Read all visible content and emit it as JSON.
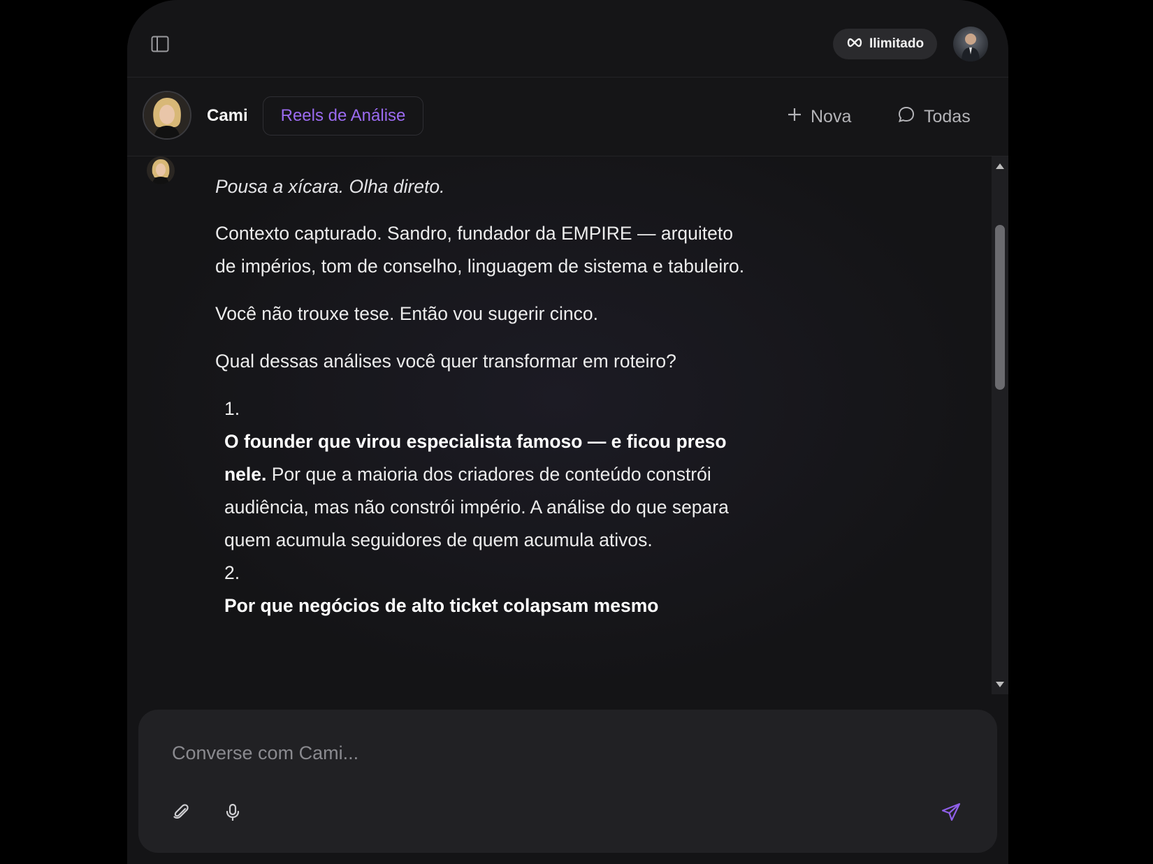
{
  "topbar": {
    "plan_label": "Ilimitado"
  },
  "header": {
    "agent_name": "Cami",
    "mode_label": "Reels de Análise",
    "new_label": "Nova",
    "all_label": "Todas"
  },
  "message": {
    "italic": "Pousa a xícara. Olha direto.",
    "para1": "Contexto capturado. Sandro, fundador da EMPIRE — arquiteto de impérios, tom de conselho, linguagem de sistema e tabuleiro.",
    "para2": "Você não trouxe tese. Então vou sugerir cinco.",
    "para3": "Qual dessas análises você quer transformar em roteiro?",
    "items": [
      {
        "num": "1.",
        "bold": "O founder que virou especialista famoso — e ficou preso nele.",
        "text": " Por que a maioria dos criadores de conteúdo constrói audiência, mas não constrói império. A análise do que separa quem acumula seguidores de quem acumula ativos."
      },
      {
        "num": "2.",
        "bold": "Por que negócios de alto ticket colapsam mesmo",
        "text": ""
      }
    ]
  },
  "composer": {
    "placeholder": "Converse com Cami..."
  },
  "colors": {
    "accent": "#9b6bf0",
    "background": "#141416",
    "composer": "#212124"
  }
}
